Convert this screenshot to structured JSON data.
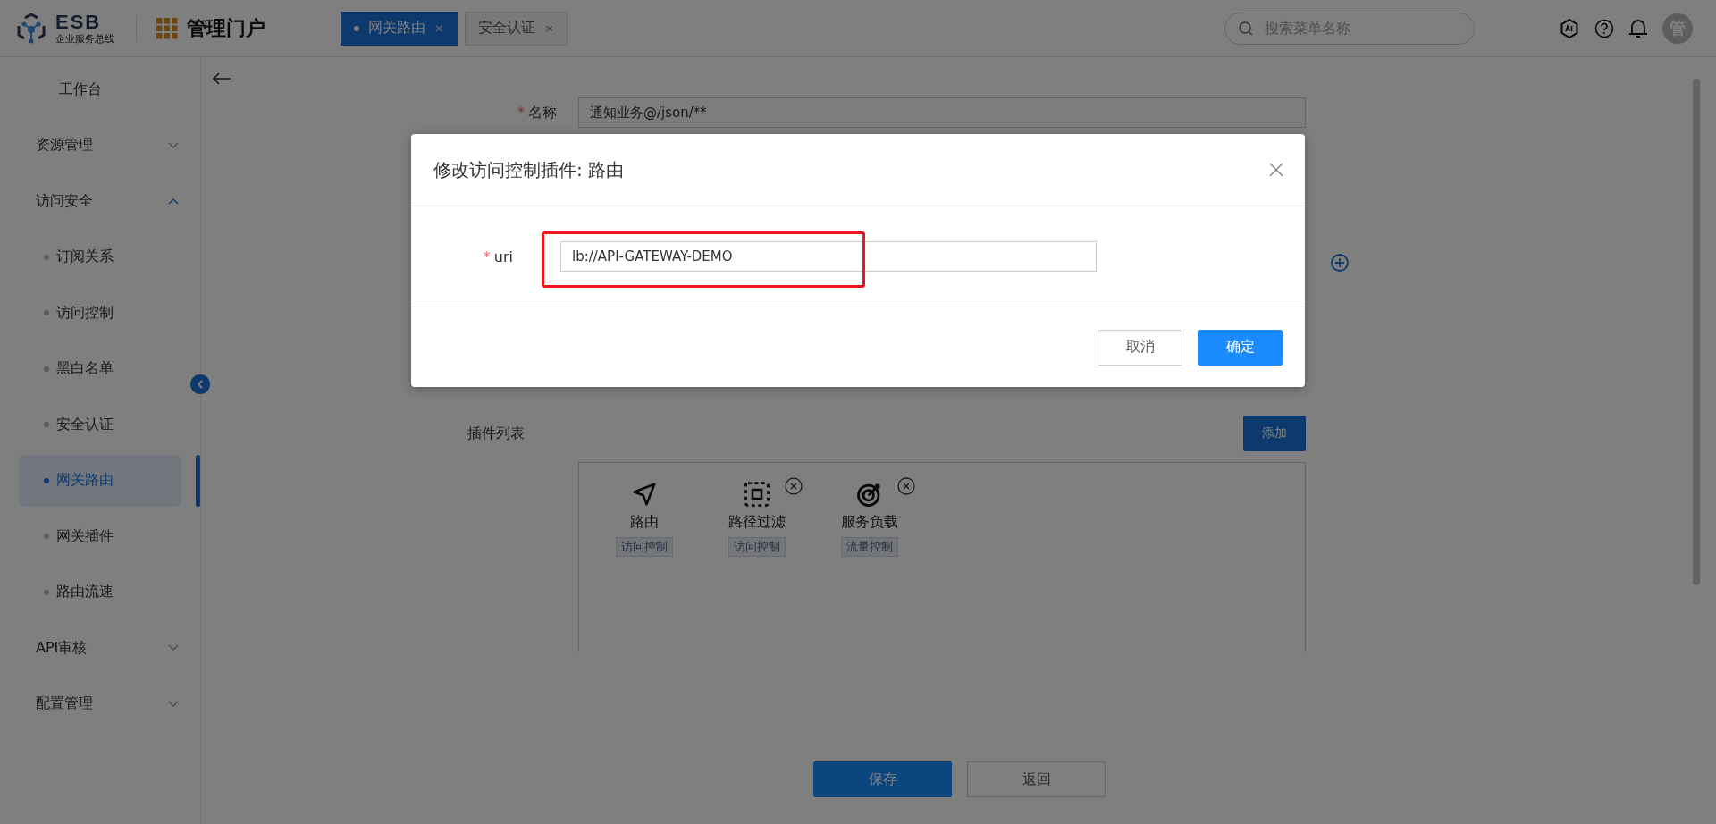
{
  "header": {
    "logo": {
      "title": "ESB",
      "subtitle": "企业服务总线"
    },
    "portal_title": "管理门户",
    "tabs": [
      {
        "label": "网关路由",
        "selected": true,
        "close": "×"
      },
      {
        "label": "安全认证",
        "selected": false,
        "close": "×"
      }
    ],
    "search": {
      "placeholder": "搜索菜单名称"
    },
    "avatar": "管"
  },
  "sidebar": {
    "items": [
      {
        "label": "工作台",
        "kind": "link"
      },
      {
        "label": "资源管理",
        "kind": "group",
        "expanded": false
      },
      {
        "label": "访问安全",
        "kind": "group",
        "expanded": true,
        "children": [
          {
            "label": "订阅关系",
            "selected": false
          },
          {
            "label": "访问控制",
            "selected": false
          },
          {
            "label": "黑白名单",
            "selected": false
          },
          {
            "label": "安全认证",
            "selected": false
          },
          {
            "label": "网关路由",
            "selected": true
          },
          {
            "label": "网关插件",
            "selected": false
          },
          {
            "label": "路由流速",
            "selected": false
          }
        ]
      },
      {
        "label": "API审核",
        "kind": "group",
        "expanded": false
      },
      {
        "label": "配置管理",
        "kind": "group",
        "expanded": false
      }
    ]
  },
  "form": {
    "fields": [
      {
        "label": "名称",
        "required_mark": "*",
        "value": "通知业务@/json/**"
      }
    ],
    "plugin_list": {
      "label": "插件列表",
      "add_button": "添加",
      "plugins": [
        {
          "name": "路由",
          "tag": "访问控制",
          "kind": "route",
          "removable": false
        },
        {
          "name": "路径过滤",
          "tag": "访问控制",
          "kind": "filter",
          "removable": true
        },
        {
          "name": "服务负载",
          "tag": "流量控制",
          "kind": "target",
          "removable": true
        }
      ]
    },
    "buttons": [
      {
        "label": "保存",
        "kind": "primary"
      },
      {
        "label": "返回",
        "kind": "default"
      }
    ]
  },
  "dialog": {
    "title": "修改访问控制插件: 路由",
    "fields": [
      {
        "label": "uri",
        "required_mark": "*",
        "value": "lb://API-GATEWAY-DEMO",
        "highlighted": true
      }
    ],
    "buttons": [
      {
        "label": "取消",
        "kind": "default"
      },
      {
        "label": "确定",
        "kind": "primary"
      }
    ]
  }
}
